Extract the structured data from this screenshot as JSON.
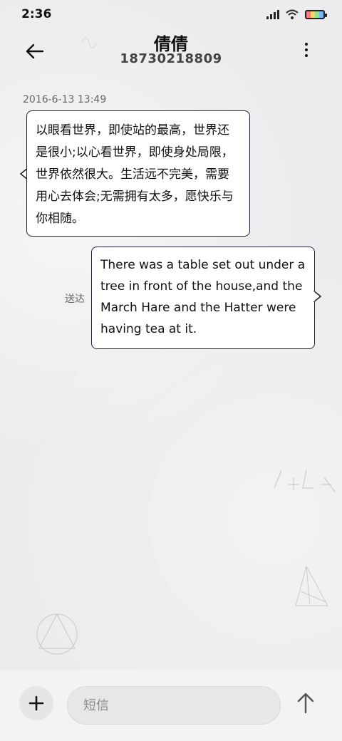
{
  "status_bar": {
    "time": "2:36"
  },
  "header": {
    "contact_name": "倩倩",
    "phone_number": "18730218809"
  },
  "conversation": {
    "timestamp": "2016-6-13 13:49",
    "incoming_message": "以眼看世界，即使站的最高，世界还是很小;以心看世界，即使身处局限，世界依然很大。生活远不完美，需要用心去体会;无需拥有太多，愿快乐与你相随。",
    "outgoing_message": "There was a table set out under a tree in front of the house,and the March Hare and the Hatter were having tea at it.",
    "delivery_status": "送达"
  },
  "composer": {
    "placeholder": "短信"
  },
  "icons": {
    "back": "arrow-left-icon",
    "more": "more-vertical-icon",
    "add": "plus-icon",
    "send": "arrow-up-icon"
  },
  "colors": {
    "bubble_border": "#1b2232",
    "background": "#ececee"
  }
}
